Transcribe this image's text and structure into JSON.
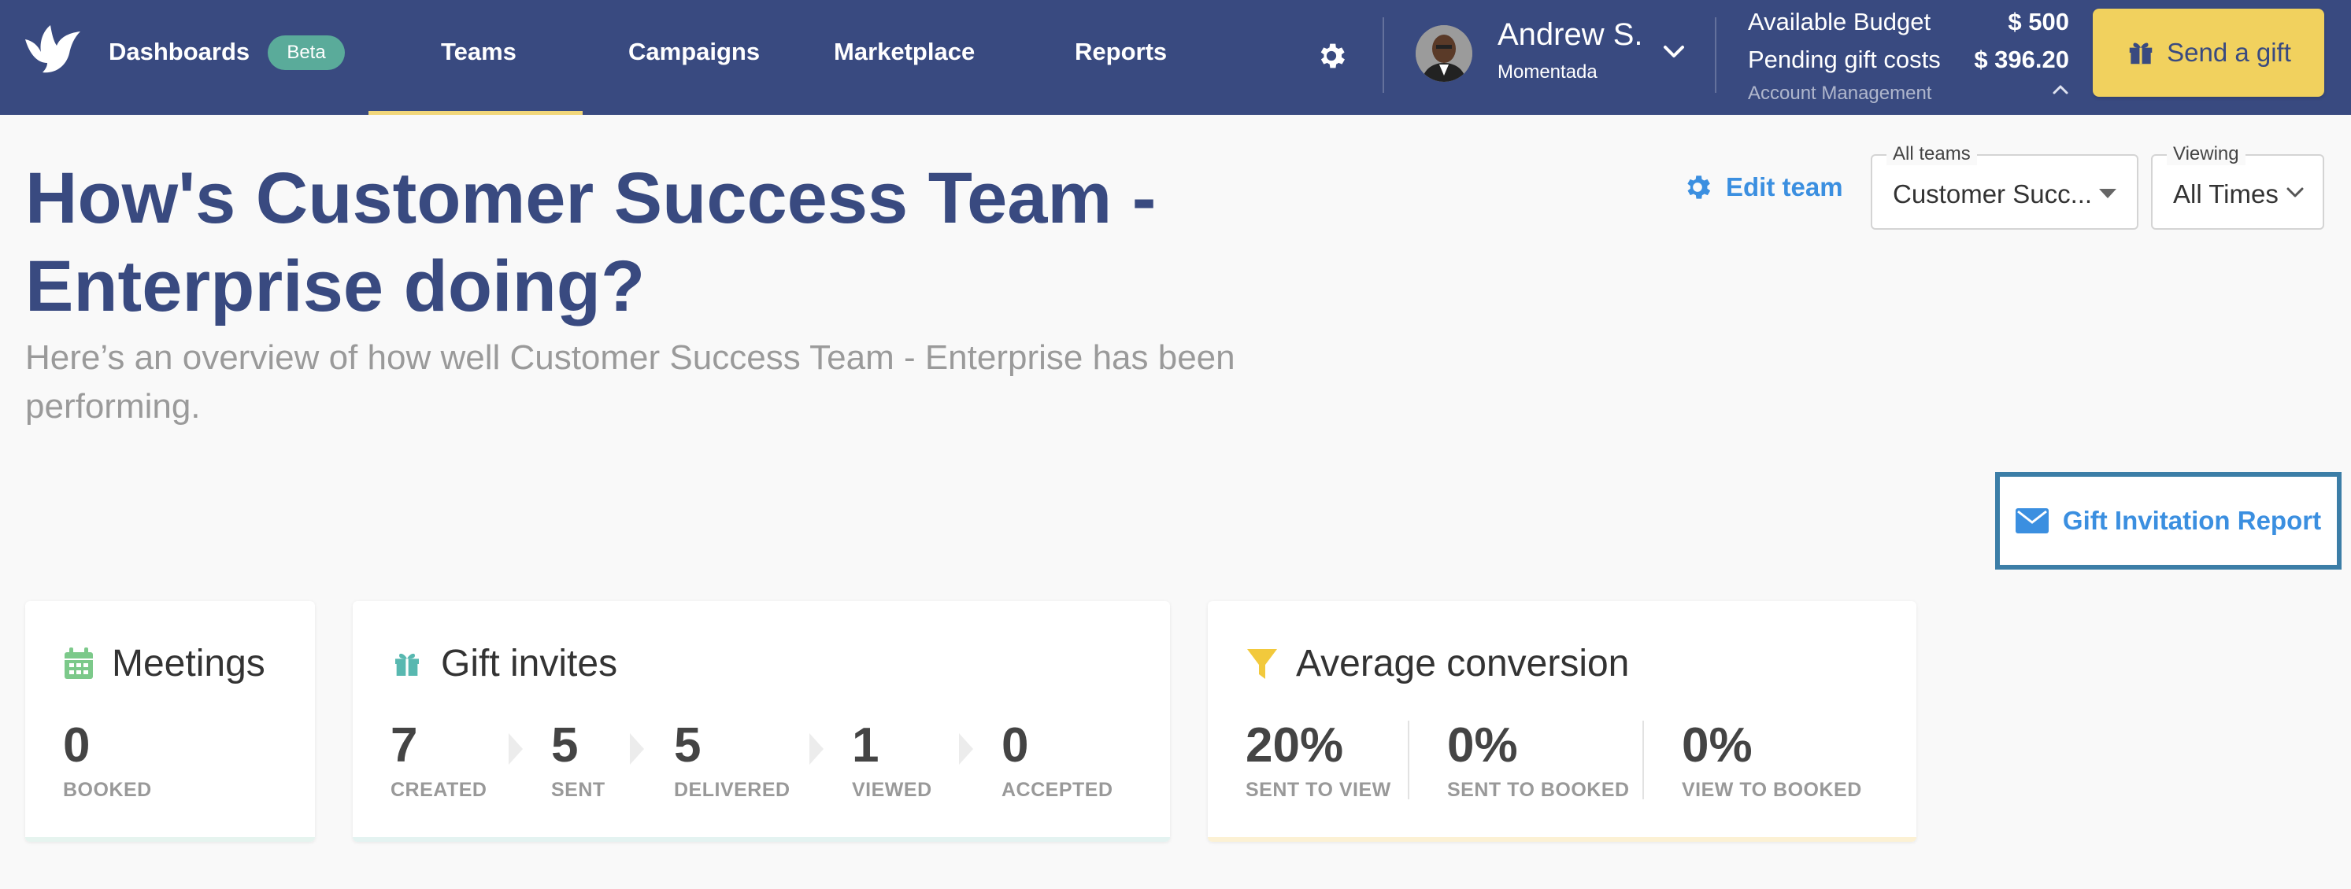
{
  "nav": {
    "dashboards": "Dashboards",
    "beta": "Beta",
    "teams": "Teams",
    "campaigns": "Campaigns",
    "marketplace": "Marketplace",
    "reports": "Reports"
  },
  "user": {
    "name": "Andrew S.",
    "org": "Momentada"
  },
  "budget": {
    "available_label": "Available Budget",
    "available_value": "$ 500",
    "pending_label": "Pending gift costs",
    "pending_value": "$ 396.20",
    "account_management": "Account Management"
  },
  "send_gift_label": "Send a gift",
  "page": {
    "title": "How's Customer Success Team - Enterprise doing?",
    "subtitle": "Here’s an overview of how well Customer Success Team - Enterprise has been performing."
  },
  "controls": {
    "edit_team": "Edit team",
    "teams_legend": "All teams",
    "teams_value": "Customer Succ...",
    "viewing_legend": "Viewing",
    "viewing_value": "All Times"
  },
  "gift_invitation_report": "Gift Invitation Report",
  "cards": {
    "meetings": {
      "title": "Meetings",
      "metrics": [
        {
          "value": "0",
          "label": "BOOKED"
        }
      ]
    },
    "gift_invites": {
      "title": "Gift invites",
      "metrics": [
        {
          "value": "7",
          "label": "CREATED"
        },
        {
          "value": "5",
          "label": "SENT"
        },
        {
          "value": "5",
          "label": "DELIVERED"
        },
        {
          "value": "1",
          "label": "VIEWED"
        },
        {
          "value": "0",
          "label": "ACCEPTED"
        }
      ]
    },
    "conversion": {
      "title": "Average conversion",
      "metrics": [
        {
          "value": "20%",
          "label": "SENT TO VIEW"
        },
        {
          "value": "0%",
          "label": "SENT TO BOOKED"
        },
        {
          "value": "0%",
          "label": "VIEW TO BOOKED"
        }
      ]
    }
  },
  "colors": {
    "nav_bg": "#394a80",
    "accent_yellow": "#f1d15e",
    "link_blue": "#3b8fe0",
    "beta_green": "#5aab9a",
    "meetings_green": "#7cc98a",
    "gift_teal": "#58b8b0",
    "funnel_yellow": "#f2c93c"
  },
  "icons": {
    "logo": "bird-logo-icon",
    "settings": "gear-icon",
    "user_menu": "chevron-down-icon",
    "account": "chevron-up-icon",
    "send_gift": "gift-icon",
    "edit_team": "gear-icon",
    "report": "envelope-icon",
    "meetings": "calendar-icon",
    "gift_invites": "gift-icon",
    "conversion": "funnel-icon"
  }
}
